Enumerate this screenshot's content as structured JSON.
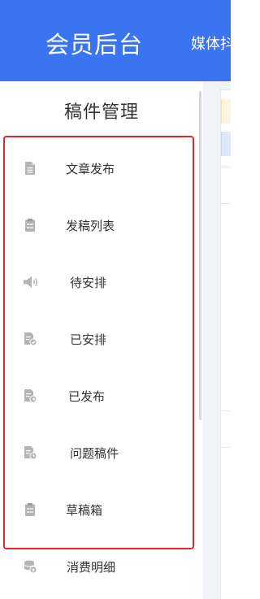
{
  "header": {
    "app_title": "会员后台",
    "top_nav_label": "媒体抖"
  },
  "sidebar": {
    "section_title": "稿件管理",
    "items": [
      {
        "label": "文章发布",
        "icon": "document-icon"
      },
      {
        "label": "发稿列表",
        "icon": "clipboard-list-icon"
      },
      {
        "label": "待安排",
        "icon": "speaker-icon"
      },
      {
        "label": "已安排",
        "icon": "document-check-icon"
      },
      {
        "label": "已发布",
        "icon": "document-upload-icon"
      },
      {
        "label": "问题稿件",
        "icon": "document-warning-icon"
      },
      {
        "label": "草稿箱",
        "icon": "clipboard-draft-icon"
      },
      {
        "label": "消费明细",
        "icon": "coins-icon"
      }
    ]
  },
  "colors": {
    "header_bg": "#3a74f0",
    "highlight_border": "#e8252b",
    "icon_gray": "#b4b4b4",
    "content_bg": "#f0f3f8"
  }
}
